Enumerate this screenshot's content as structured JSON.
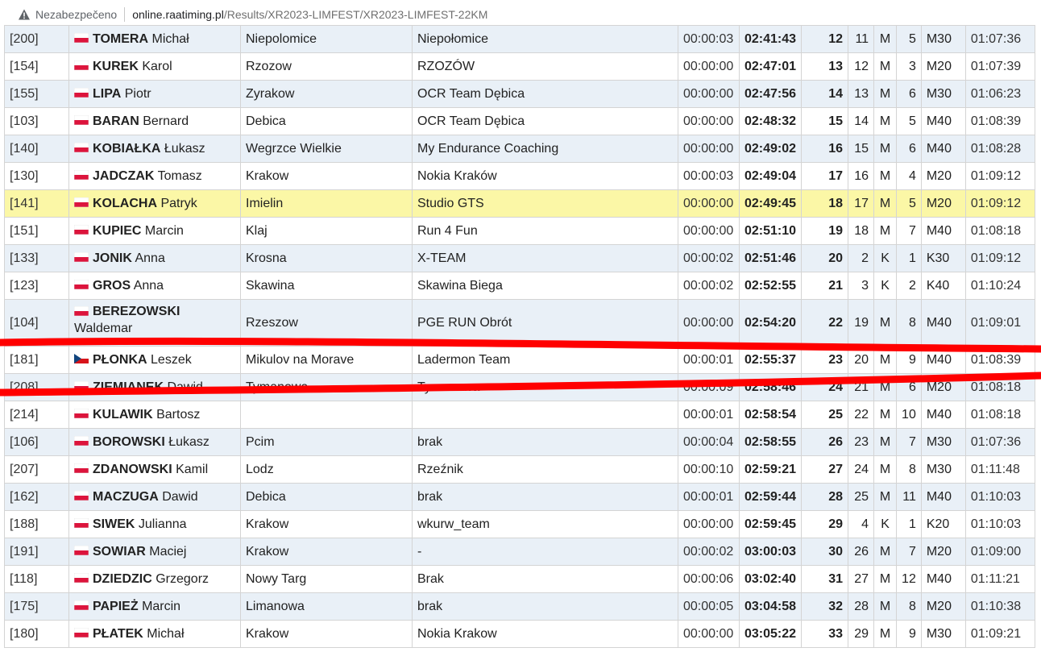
{
  "browser": {
    "security_label": "Nezabezpečeno",
    "url_host": "online.raatiming.pl",
    "url_path": "/Results/XR2023-LIMFEST/XR2023-LIMFEST-22KM"
  },
  "colors": {
    "row_odd": "#e9f0f7",
    "row_even": "#ffffff",
    "row_highlight": "#fbf7a6",
    "border": "#d4d4d4",
    "annotation_red": "#ff0000"
  },
  "rows": [
    {
      "bib": "[200]",
      "flag": "pl",
      "surname": "TOMERA",
      "first": "Michał",
      "city": "Niepolomice",
      "club": "Niepołomice",
      "start": "00:00:03",
      "time": "02:41:43",
      "place": "12",
      "gender_place": "11",
      "sex": "M",
      "cat_place": "5",
      "category": "M30",
      "split": "01:07:36",
      "style": "odd"
    },
    {
      "bib": "[154]",
      "flag": "pl",
      "surname": "KUREK",
      "first": "Karol",
      "city": "Rzozow",
      "club": "RZOZÓW",
      "start": "00:00:00",
      "time": "02:47:01",
      "place": "13",
      "gender_place": "12",
      "sex": "M",
      "cat_place": "3",
      "category": "M20",
      "split": "01:07:39",
      "style": "even"
    },
    {
      "bib": "[155]",
      "flag": "pl",
      "surname": "LIPA",
      "first": "Piotr",
      "city": "Zyrakow",
      "club": "OCR Team Dębica",
      "start": "00:00:00",
      "time": "02:47:56",
      "place": "14",
      "gender_place": "13",
      "sex": "M",
      "cat_place": "6",
      "category": "M30",
      "split": "01:06:23",
      "style": "odd"
    },
    {
      "bib": "[103]",
      "flag": "pl",
      "surname": "BARAN",
      "first": "Bernard",
      "city": "Debica",
      "club": "OCR Team Dębica",
      "start": "00:00:00",
      "time": "02:48:32",
      "place": "15",
      "gender_place": "14",
      "sex": "M",
      "cat_place": "5",
      "category": "M40",
      "split": "01:08:39",
      "style": "even"
    },
    {
      "bib": "[140]",
      "flag": "pl",
      "surname": "KOBIAŁKA",
      "first": "Łukasz",
      "city": "Wegrzce Wielkie",
      "club": "My Endurance Coaching",
      "start": "00:00:00",
      "time": "02:49:02",
      "place": "16",
      "gender_place": "15",
      "sex": "M",
      "cat_place": "6",
      "category": "M40",
      "split": "01:08:28",
      "style": "odd"
    },
    {
      "bib": "[130]",
      "flag": "pl",
      "surname": "JADCZAK",
      "first": "Tomasz",
      "city": "Krakow",
      "club": "Nokia Kraków",
      "start": "00:00:03",
      "time": "02:49:04",
      "place": "17",
      "gender_place": "16",
      "sex": "M",
      "cat_place": "4",
      "category": "M20",
      "split": "01:09:12",
      "style": "even"
    },
    {
      "bib": "[141]",
      "flag": "pl",
      "surname": "KOLACHA",
      "first": "Patryk",
      "city": "Imielin",
      "club": "Studio GTS",
      "start": "00:00:00",
      "time": "02:49:45",
      "place": "18",
      "gender_place": "17",
      "sex": "M",
      "cat_place": "5",
      "category": "M20",
      "split": "01:09:12",
      "style": "hl"
    },
    {
      "bib": "[151]",
      "flag": "pl",
      "surname": "KUPIEC",
      "first": "Marcin",
      "city": "Klaj",
      "club": "Run 4 Fun",
      "start": "00:00:00",
      "time": "02:51:10",
      "place": "19",
      "gender_place": "18",
      "sex": "M",
      "cat_place": "7",
      "category": "M40",
      "split": "01:08:18",
      "style": "even"
    },
    {
      "bib": "[133]",
      "flag": "pl",
      "surname": "JONIK",
      "first": "Anna",
      "city": "Krosna",
      "club": "X-TEAM",
      "start": "00:00:02",
      "time": "02:51:46",
      "place": "20",
      "gender_place": "2",
      "sex": "K",
      "cat_place": "1",
      "category": "K30",
      "split": "01:09:12",
      "style": "odd"
    },
    {
      "bib": "[123]",
      "flag": "pl",
      "surname": "GROS",
      "first": "Anna",
      "city": "Skawina",
      "club": "Skawina Biega",
      "start": "00:00:02",
      "time": "02:52:55",
      "place": "21",
      "gender_place": "3",
      "sex": "K",
      "cat_place": "2",
      "category": "K40",
      "split": "01:10:24",
      "style": "even"
    },
    {
      "bib": "[104]",
      "flag": "pl",
      "surname": "BEREZOWSKI",
      "first": "Waldemar",
      "city": "Rzeszow",
      "club": "PGE RUN Obrót",
      "start": "00:00:00",
      "time": "02:54:20",
      "place": "22",
      "gender_place": "19",
      "sex": "M",
      "cat_place": "8",
      "category": "M40",
      "split": "01:09:01",
      "style": "odd",
      "tall": true
    },
    {
      "bib": "[181]",
      "flag": "cz",
      "surname": "PŁONKA",
      "first": "Leszek",
      "city": "Mikulov na Morave",
      "club": "Ladermon Team",
      "start": "00:00:01",
      "time": "02:55:37",
      "place": "23",
      "gender_place": "20",
      "sex": "M",
      "cat_place": "9",
      "category": "M40",
      "split": "01:08:39",
      "style": "even"
    },
    {
      "bib": "[208]",
      "flag": "pl",
      "surname": "ZIEMIANEK",
      "first": "Dawid",
      "city": "Tymanowa",
      "club": "Tymanowa",
      "start": "00:00:09",
      "time": "02:58:46",
      "place": "24",
      "gender_place": "21",
      "sex": "M",
      "cat_place": "6",
      "category": "M20",
      "split": "01:08:18",
      "style": "odd"
    },
    {
      "bib": "[214]",
      "flag": "pl",
      "surname": "KULAWIK",
      "first": "Bartosz",
      "city": "",
      "club": "",
      "start": "00:00:01",
      "time": "02:58:54",
      "place": "25",
      "gender_place": "22",
      "sex": "M",
      "cat_place": "10",
      "category": "M40",
      "split": "01:08:18",
      "style": "even"
    },
    {
      "bib": "[106]",
      "flag": "pl",
      "surname": "BOROWSKI",
      "first": "Łukasz",
      "city": "Pcim",
      "club": "brak",
      "start": "00:00:04",
      "time": "02:58:55",
      "place": "26",
      "gender_place": "23",
      "sex": "M",
      "cat_place": "7",
      "category": "M30",
      "split": "01:07:36",
      "style": "odd"
    },
    {
      "bib": "[207]",
      "flag": "pl",
      "surname": "ZDANOWSKI",
      "first": "Kamil",
      "city": "Lodz",
      "club": "Rzeźnik",
      "start": "00:00:10",
      "time": "02:59:21",
      "place": "27",
      "gender_place": "24",
      "sex": "M",
      "cat_place": "8",
      "category": "M30",
      "split": "01:11:48",
      "style": "even"
    },
    {
      "bib": "[162]",
      "flag": "pl",
      "surname": "MACZUGA",
      "first": "Dawid",
      "city": "Debica",
      "club": "brak",
      "start": "00:00:01",
      "time": "02:59:44",
      "place": "28",
      "gender_place": "25",
      "sex": "M",
      "cat_place": "11",
      "category": "M40",
      "split": "01:10:03",
      "style": "odd"
    },
    {
      "bib": "[188]",
      "flag": "pl",
      "surname": "SIWEK",
      "first": "Julianna",
      "city": "Krakow",
      "club": "wkurw_team",
      "start": "00:00:00",
      "time": "02:59:45",
      "place": "29",
      "gender_place": "4",
      "sex": "K",
      "cat_place": "1",
      "category": "K20",
      "split": "01:10:03",
      "style": "even"
    },
    {
      "bib": "[191]",
      "flag": "pl",
      "surname": "SOWIAR",
      "first": "Maciej",
      "city": "Krakow",
      "club": "-",
      "start": "00:00:02",
      "time": "03:00:03",
      "place": "30",
      "gender_place": "26",
      "sex": "M",
      "cat_place": "7",
      "category": "M20",
      "split": "01:09:00",
      "style": "odd"
    },
    {
      "bib": "[118]",
      "flag": "pl",
      "surname": "DZIEDZIC",
      "first": "Grzegorz",
      "city": "Nowy Targ",
      "club": "Brak",
      "start": "00:00:06",
      "time": "03:02:40",
      "place": "31",
      "gender_place": "27",
      "sex": "M",
      "cat_place": "12",
      "category": "M40",
      "split": "01:11:21",
      "style": "even"
    },
    {
      "bib": "[175]",
      "flag": "pl",
      "surname": "PAPIEŻ",
      "first": "Marcin",
      "city": "Limanowa",
      "club": "brak",
      "start": "00:00:05",
      "time": "03:04:58",
      "place": "32",
      "gender_place": "28",
      "sex": "M",
      "cat_place": "8",
      "category": "M20",
      "split": "01:10:38",
      "style": "odd"
    },
    {
      "bib": "[180]",
      "flag": "pl",
      "surname": "PŁATEK",
      "first": "Michał",
      "city": "Krakow",
      "club": "Nokia Krakow",
      "start": "00:00:00",
      "time": "03:05:22",
      "place": "33",
      "gender_place": "29",
      "sex": "M",
      "cat_place": "9",
      "category": "M30",
      "split": "01:09:21",
      "style": "even"
    }
  ]
}
